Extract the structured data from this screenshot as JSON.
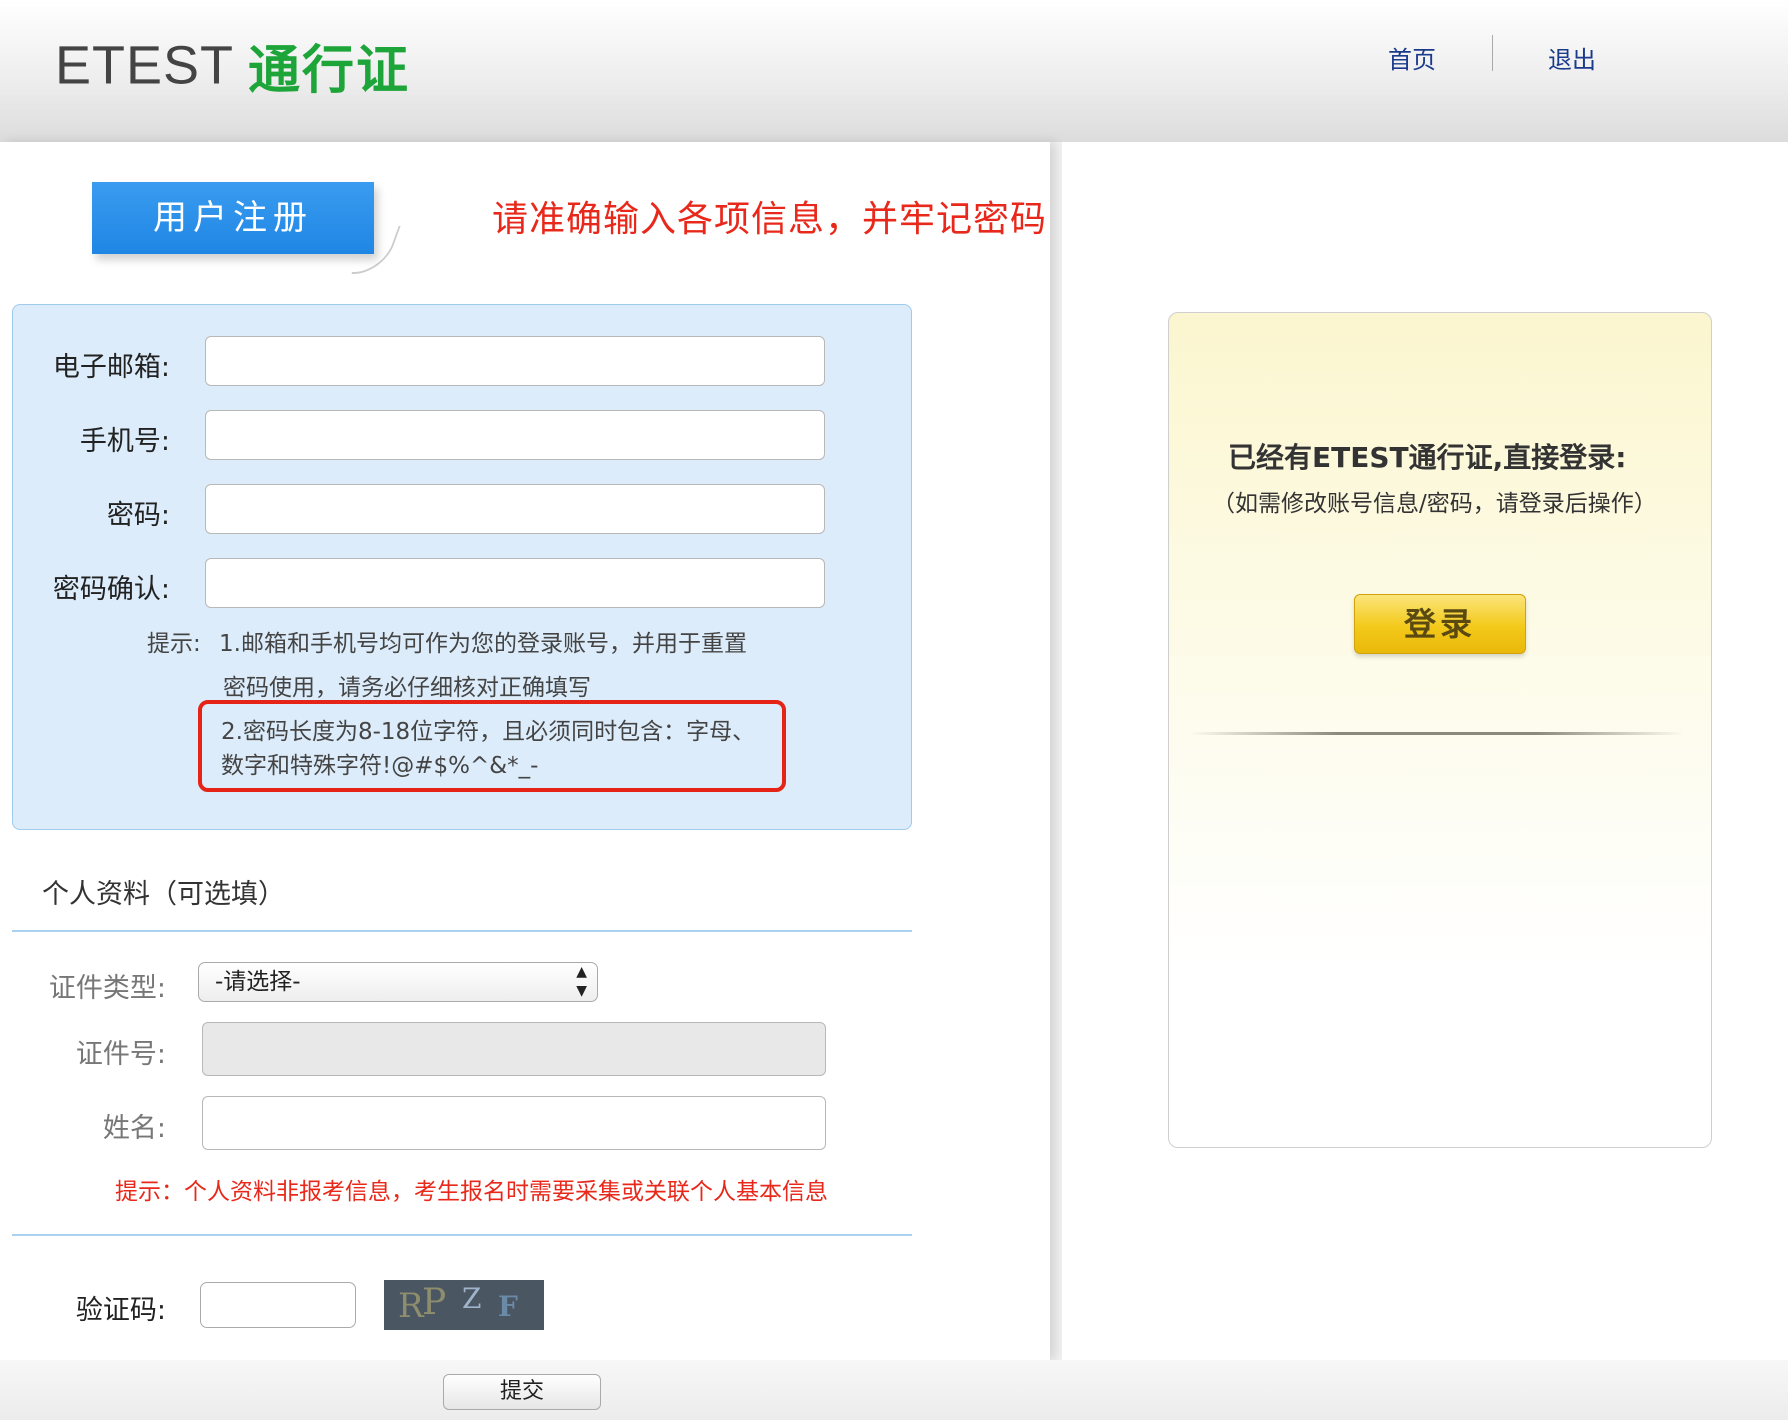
{
  "header": {
    "logo_en": "ETEST",
    "logo_cn": "通行证",
    "nav_home": "首页",
    "nav_logout": "退出"
  },
  "registration": {
    "tab_label": "用户注册",
    "notice": "请准确输入各项信息，并牢记密码",
    "fields": {
      "email_label": "电子邮箱:",
      "phone_label": "手机号:",
      "password_label": "密码:",
      "confirm_label": "密码确认:"
    },
    "hints": {
      "prefix": "提示:",
      "line1": "1.邮箱和手机号均可作为您的登录账号，并用于重置",
      "line2": "密码使用，请务必仔细核对正确填写",
      "line3": "2.密码长度为8-18位字符，且必须同时包含：字母、",
      "line4": "数字和特殊字符!@#$%^&*_-"
    }
  },
  "personal": {
    "title": "个人资料（可选填）",
    "id_type_label": "证件类型:",
    "id_type_selected": "-请选择-",
    "id_number_label": "证件号:",
    "name_label": "姓名:",
    "hint": "提示：个人资料非报考信息，考生报名时需要采集或关联个人基本信息"
  },
  "captcha": {
    "label": "验证码:",
    "image_text": "RPZF"
  },
  "submit_label": "提交",
  "login": {
    "title": "已经有ETEST通行证,直接登录:",
    "subtitle": "（如需修改账号信息/密码，请登录后操作）",
    "button_label": "登录"
  },
  "colors": {
    "brand_green": "#1ea53a",
    "tab_blue": "#1f86e4",
    "notice_red": "#e8281a",
    "nav_blue": "#1a3b8c",
    "login_gold": "#f3c91a"
  }
}
